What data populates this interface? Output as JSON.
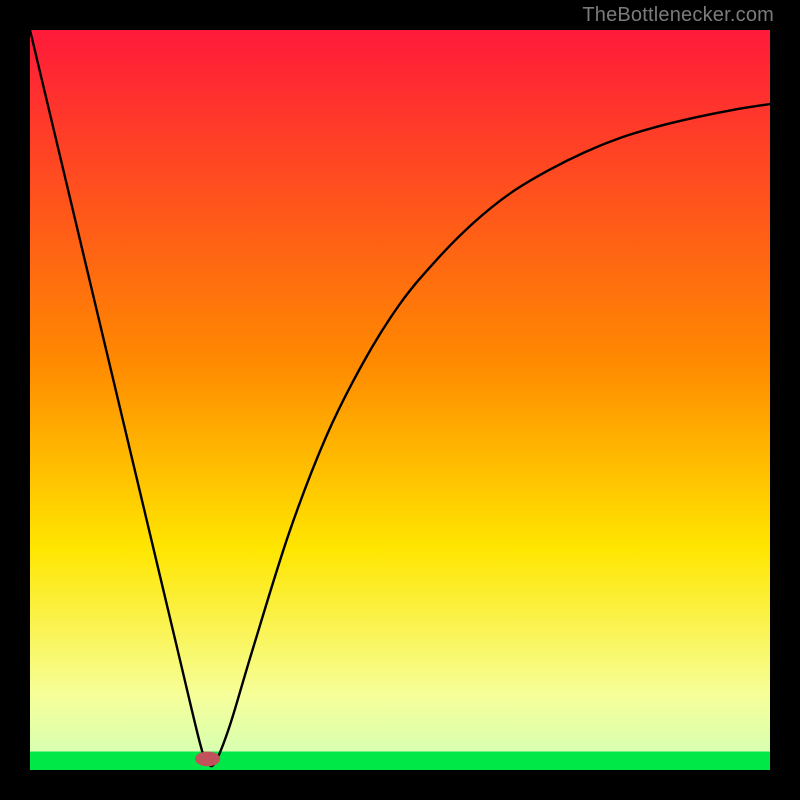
{
  "watermark": "TheBottlenecker.com",
  "colors": {
    "top": "#ff1a3a",
    "mid": "#ffd400",
    "green": "#00e848",
    "curve": "#000000",
    "marker": "#c1515b",
    "bg": "#000000"
  },
  "chart_data": {
    "type": "line",
    "title": "",
    "xlabel": "",
    "ylabel": "",
    "xlim": [
      0,
      100
    ],
    "ylim": [
      0,
      100
    ],
    "series": [
      {
        "name": "bottleneck-curve",
        "x": [
          0,
          5,
          10,
          15,
          20,
          23,
          24,
          25,
          27,
          30,
          35,
          40,
          45,
          50,
          55,
          60,
          65,
          70,
          75,
          80,
          85,
          90,
          95,
          100
        ],
        "values": [
          100,
          79,
          58,
          37,
          16,
          3.5,
          1,
          1,
          6,
          16,
          32,
          45,
          55,
          63,
          69,
          74,
          78,
          81,
          83.5,
          85.5,
          87,
          88.2,
          89.2,
          90
        ]
      }
    ],
    "marker": {
      "x": 24,
      "y": 1.5,
      "rx": 1.7,
      "ry": 1.0
    },
    "bands": {
      "green_start_y": 2.5,
      "pale_yellow_start_y": 25,
      "yellow_core_y": 50,
      "orange_y": 75
    }
  }
}
